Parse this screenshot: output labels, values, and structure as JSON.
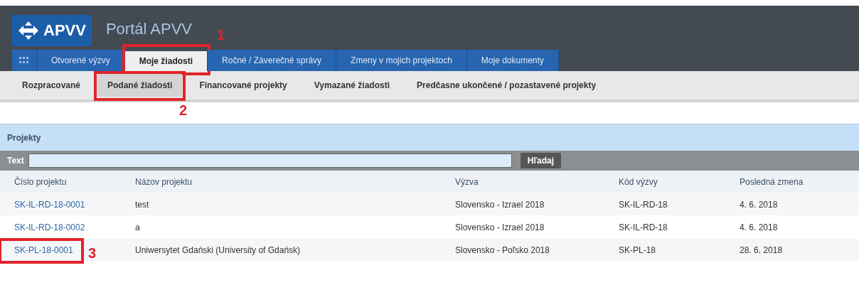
{
  "header": {
    "logo": "APVV",
    "title": "Portál APVV"
  },
  "tabs": [
    {
      "label": "Otvorené výzvy",
      "selected": false
    },
    {
      "label": "Moje žiadosti",
      "selected": true,
      "callout": "1"
    },
    {
      "label": "Ročné / Záverečné správy",
      "selected": false
    },
    {
      "label": "Zmeny v mojich projektoch",
      "selected": false
    },
    {
      "label": "Moje dokumenty",
      "selected": false
    }
  ],
  "subtabs": [
    {
      "label": "Rozpracované",
      "selected": false
    },
    {
      "label": "Podané žiadosti",
      "selected": true,
      "callout": "2"
    },
    {
      "label": "Financované projekty",
      "selected": false
    },
    {
      "label": "Vymazané žiadosti",
      "selected": false
    },
    {
      "label": "Predčasne ukončené / pozastavené projekty",
      "selected": false
    }
  ],
  "panel": {
    "title": "Projekty"
  },
  "search": {
    "label": "Text",
    "button": "Hľadaj"
  },
  "table": {
    "columns": [
      "Číslo projektu",
      "Názov projektu",
      "Výzva",
      "Kód výzvy",
      "Posledná zmena"
    ],
    "rows": [
      {
        "cells": [
          "SK-IL-RD-18-0001",
          "test",
          "Slovensko - Izrael 2018",
          "SK-IL-RD-18",
          "4. 6. 2018"
        ]
      },
      {
        "cells": [
          "SK-IL-RD-18-0002",
          "a",
          "Slovensko - Izrael 2018",
          "SK-IL-RD-18",
          "4. 6. 2018"
        ]
      },
      {
        "cells": [
          "SK-PL-18-0001",
          "Uniwersytet Gdański (University of Gdańsk)",
          "Slovensko - Poľsko 2018",
          "SK-PL-18",
          "28. 6. 2018"
        ],
        "callout": "3"
      }
    ]
  }
}
